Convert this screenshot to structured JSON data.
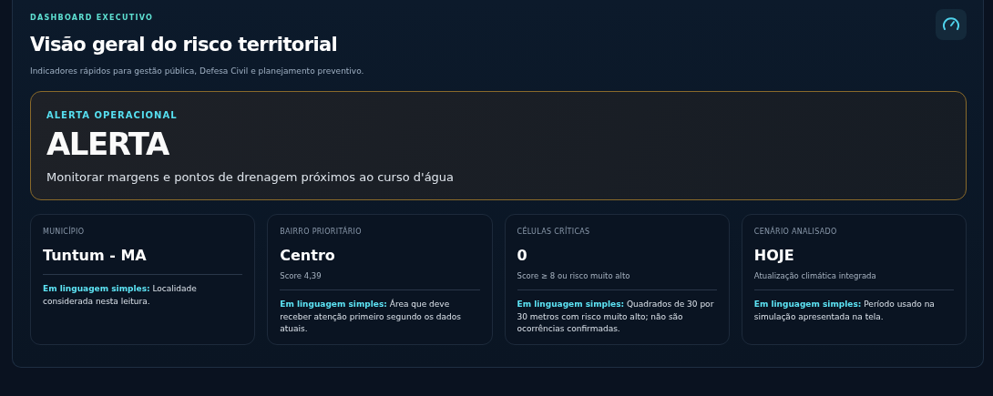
{
  "header": {
    "eyebrow": "DASHBOARD EXECUTIVO",
    "title": "Visão geral do risco territorial",
    "subtitle": "Indicadores rápidos para gestão pública, Defesa Civil e planejamento preventivo."
  },
  "alert": {
    "label": "ALERTA OPERACIONAL",
    "level_text": "ALERTA",
    "message": "Monitorar margens e pontos de drenagem próximos ao curso d'água",
    "color": "#8a6a2a"
  },
  "cards": [
    {
      "label": "MUNICÍPIO",
      "value": "Tuntum - MA",
      "note": "**Em linguagem simples:** Localidade considerada nesta leitura."
    },
    {
      "label": "BAIRRO PRIORITÁRIO",
      "value": "Centro",
      "detail": "Score 4,39",
      "note": "**Em linguagem simples:** Área que deve receber atenção primeiro segundo os dados atuais."
    },
    {
      "label": "CÉLULAS CRÍTICAS",
      "value": "0",
      "detail": "Score ≥ 8 ou risco muito alto",
      "note": "**Em linguagem simples:** Quadrados de 30 por 30 metros com risco muito alto; não são ocorrências confirmadas."
    },
    {
      "label": "CENÁRIO ANALISADO",
      "value": "HOJE",
      "detail": "Atualização climática integrada",
      "note": "**Em linguagem simples:** Período usado na simulação apresentada na tela."
    }
  ]
}
